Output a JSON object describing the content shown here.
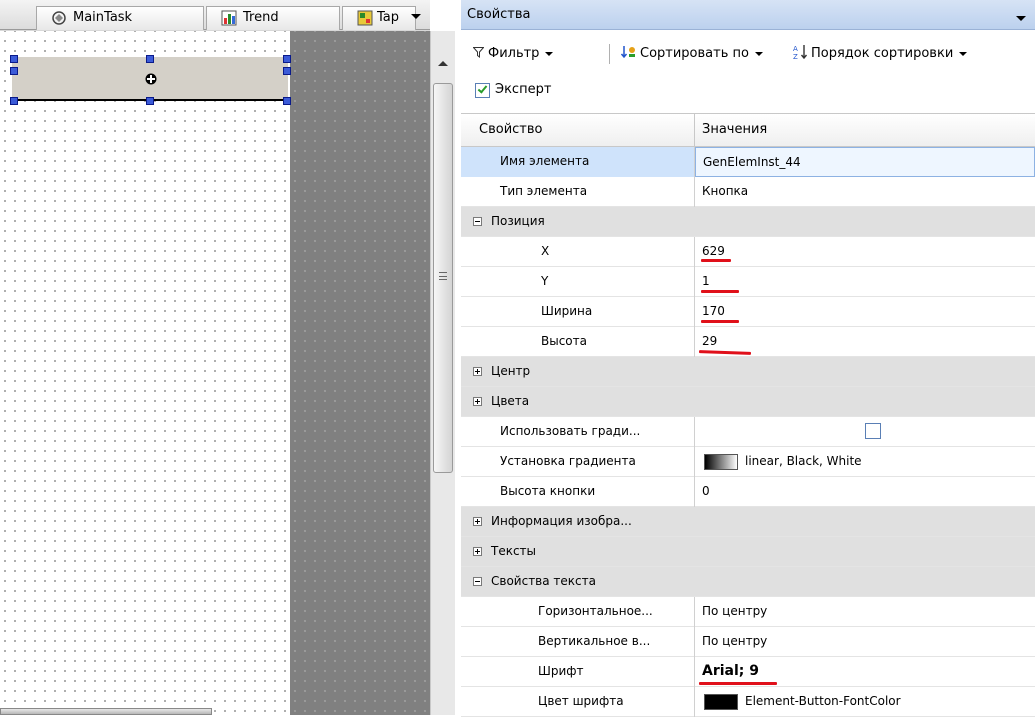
{
  "editor": {
    "tabs": [
      {
        "label": "MainTask",
        "icon": "task-icon"
      },
      {
        "label": "Trend",
        "icon": "trend-icon"
      },
      {
        "label": "Tap",
        "icon": "visualization-icon"
      }
    ]
  },
  "panel": {
    "title": "Свойства",
    "toolbar": {
      "filter": "Фильтр",
      "sort_by": "Сортировать по",
      "sort_order": "Порядок сортировки",
      "expert": "Эксперт",
      "expert_checked": true
    },
    "grid": {
      "header": {
        "property": "Свойство",
        "value": "Значения"
      },
      "rows": [
        {
          "name": "Имя элемента",
          "value": "GenElemInst_44",
          "selected": true
        },
        {
          "name": "Тип элемента",
          "value": "Кнопка"
        },
        {
          "name": "Позиция",
          "category": true,
          "expanded": true
        },
        {
          "name": "X",
          "value": "629"
        },
        {
          "name": "Y",
          "value": "1"
        },
        {
          "name": "Ширина",
          "value": "170"
        },
        {
          "name": "Высота",
          "value": "29"
        },
        {
          "name": "Центр",
          "category": true,
          "expanded": false
        },
        {
          "name": "Цвета",
          "category": true,
          "expanded": false
        },
        {
          "name": "Использовать гради...",
          "value": "",
          "checkbox": false
        },
        {
          "name": "Установка градиента",
          "value": "linear, Black, White",
          "swatch": "gradient"
        },
        {
          "name": "Высота кнопки",
          "value": "0"
        },
        {
          "name": "Информация изобра...",
          "category": true,
          "expanded": false
        },
        {
          "name": "Тексты",
          "category": true,
          "expanded": false
        },
        {
          "name": "Свойства текста",
          "category": true,
          "expanded": true
        },
        {
          "name": "Горизонтальное...",
          "value": "По центру"
        },
        {
          "name": "Вертикальное в...",
          "value": "По центру"
        },
        {
          "name": "Шрифт",
          "value": "Arial; 9"
        },
        {
          "name": "Цвет шрифта",
          "value": "Element-Button-FontColor",
          "swatch": "black"
        }
      ]
    }
  },
  "colors": {
    "selection": "#cfe3fb",
    "category_bg": "#e0e0e0",
    "handle": "#3b5bd8",
    "annotation_underline": "#e0101a"
  }
}
